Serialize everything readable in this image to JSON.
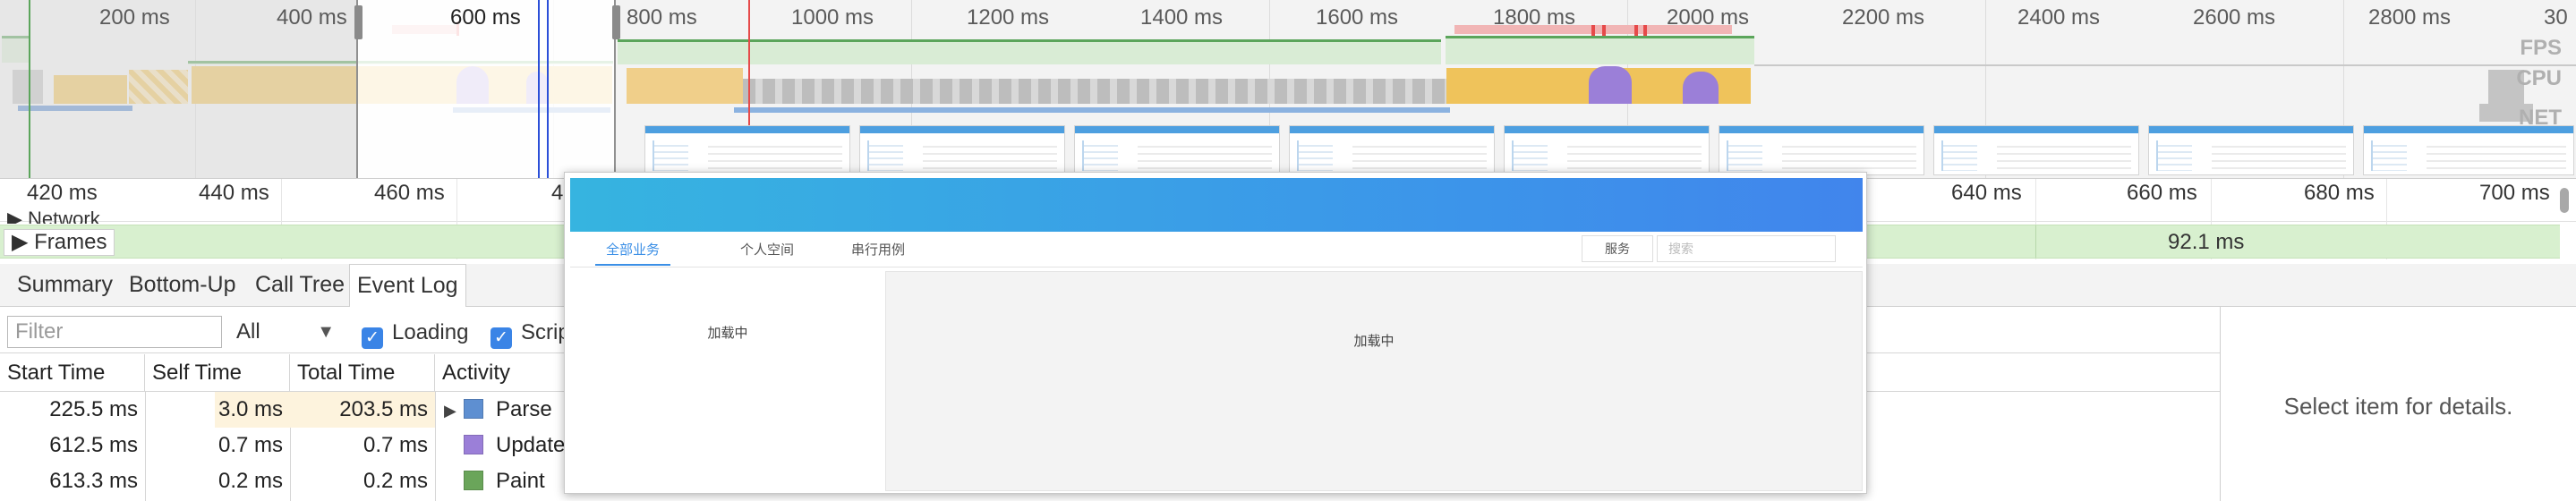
{
  "overview": {
    "ticks": [
      "200 ms",
      "400 ms",
      "600 ms",
      "800 ms",
      "1000 ms",
      "1200 ms",
      "1400 ms",
      "1600 ms",
      "1800 ms",
      "2000 ms",
      "2200 ms",
      "2400 ms",
      "2600 ms",
      "2800 ms",
      "30"
    ],
    "track_labels": {
      "fps": "FPS",
      "cpu": "CPU",
      "net": "NET"
    },
    "colors": {
      "loading": "#5e8fd1",
      "scripting": "#efc35b",
      "rendering": "#9b7fd8",
      "painting": "#6aa55a",
      "fps": "#5ba55b",
      "marker_red": "#e64a4a"
    }
  },
  "ruler": {
    "ticks": [
      "420 ms",
      "440 ms",
      "460 ms",
      "4",
      "640 ms",
      "660 ms",
      "680 ms",
      "700 ms"
    ]
  },
  "network_row": {
    "label": "▶ Network"
  },
  "frames_row": {
    "label": "▶ Frames",
    "duration": "92.1 ms"
  },
  "tabs": [
    "Summary",
    "Bottom-Up",
    "Call Tree",
    "Event Log"
  ],
  "active_tab": "Event Log",
  "filter": {
    "placeholder": "Filter",
    "duration": "All",
    "checkboxes": [
      {
        "label": "Loading",
        "checked": true
      },
      {
        "label": "Scrip",
        "checked": true
      }
    ]
  },
  "table": {
    "columns": [
      "Start Time",
      "Self Time",
      "Total Time",
      "Activity"
    ],
    "rows": [
      {
        "start": "225.5 ms",
        "self": "3.0 ms",
        "total": "203.5 ms",
        "activity": "Parse",
        "category_color": "#5e8fd1",
        "expandable": true
      },
      {
        "start": "612.5 ms",
        "self": "0.7 ms",
        "total": "0.7 ms",
        "activity": "Update",
        "category_color": "#9b7fd8",
        "expandable": false
      },
      {
        "start": "613.3 ms",
        "self": "0.2 ms",
        "total": "0.2 ms",
        "activity": "Paint",
        "category_color": "#6aa55a",
        "expandable": false
      }
    ]
  },
  "details": {
    "empty_text": "Select item for details."
  },
  "popover": {
    "nav_tabs": [
      "全部业务",
      "个人空间",
      "串行用例"
    ],
    "active_nav": "全部业务",
    "service_label": "服务",
    "search_placeholder": "搜索",
    "left_loading": "加载中",
    "right_loading": "加载中"
  }
}
